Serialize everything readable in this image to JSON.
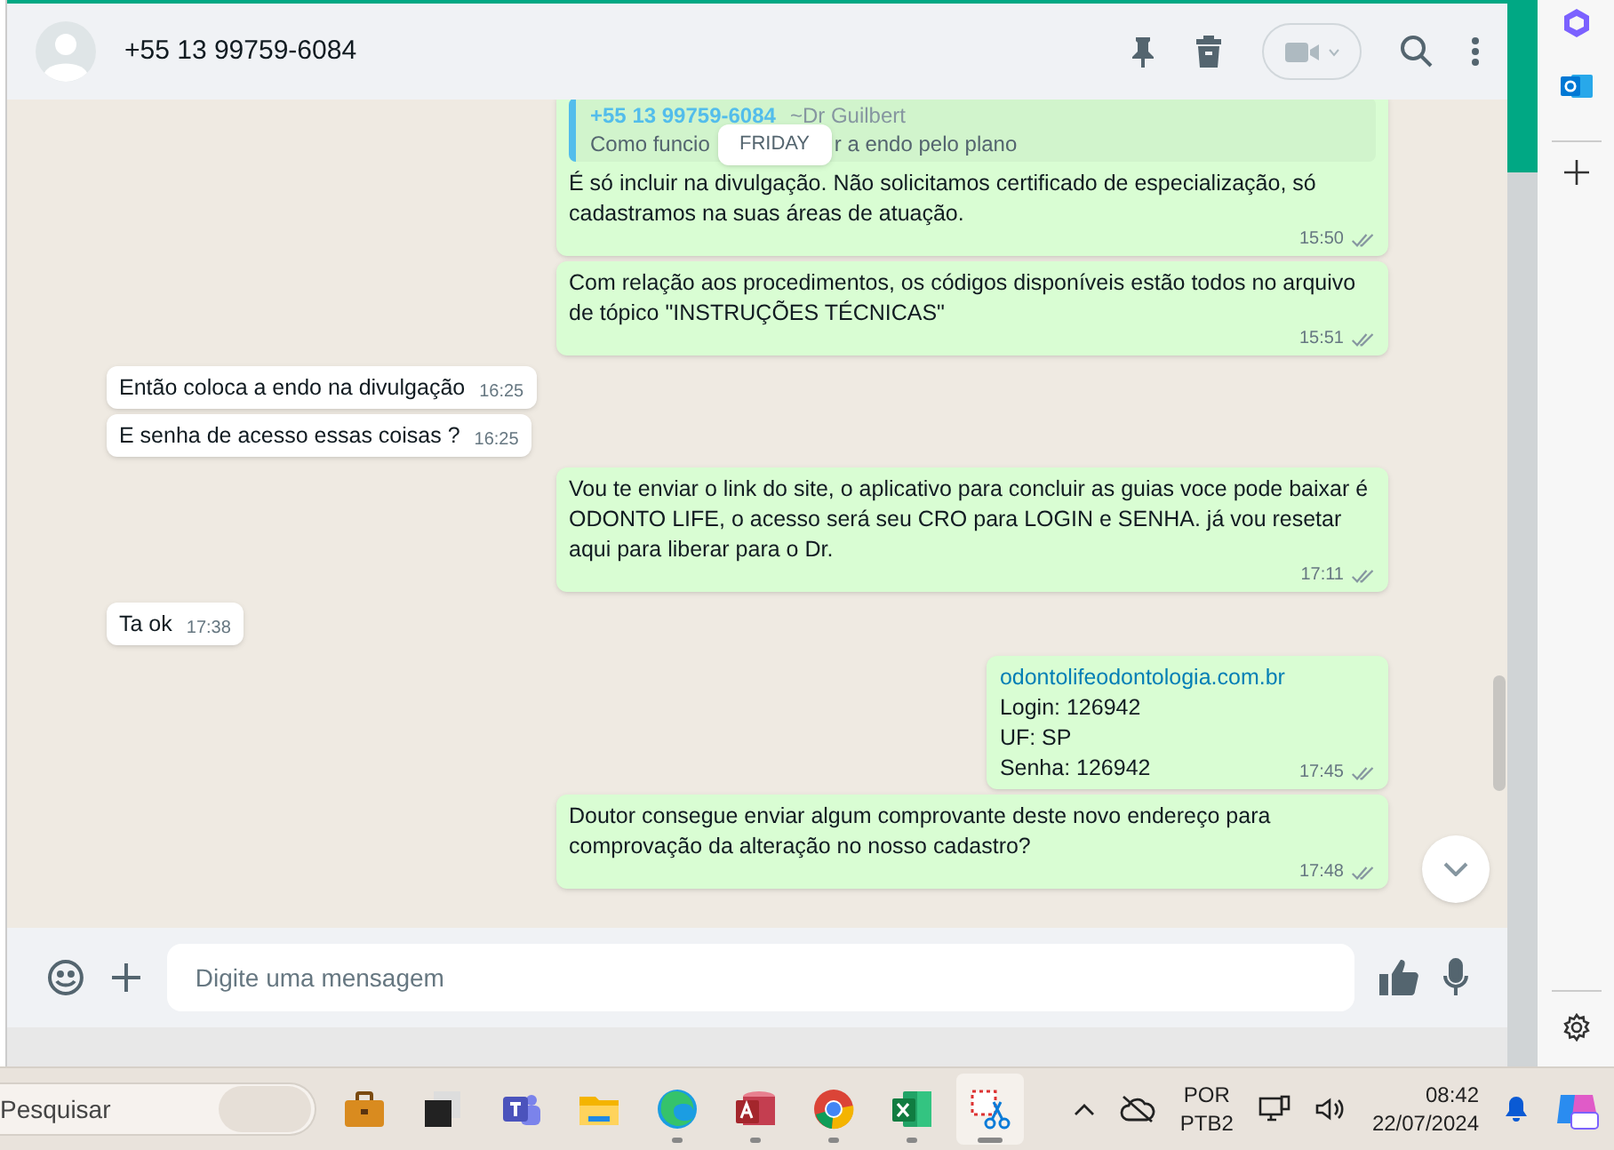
{
  "contact": {
    "name": "+55 13 99759-6084"
  },
  "date_badge": "FRIDAY",
  "messages": [
    {
      "outgoing": true,
      "quote": {
        "author": "+55 13 99759-6084",
        "author_note": "~Dr Guilbert",
        "text_parts": [
          "Como funcio",
          "r a endo pelo plano"
        ]
      },
      "lines": [
        {
          "kind": "text",
          "text": "É só incluir na divulgação. Não solicitamos certificado de especialização, só cadastramos na suas áreas de atuação."
        }
      ],
      "time": "15:50",
      "read": false
    },
    {
      "outgoing": true,
      "lines": [
        {
          "kind": "text",
          "text": "Com relação aos procedimentos, os códigos disponíveis estão todos no arquivo de tópico \"INSTRUÇÕES TÉCNICAS\""
        }
      ],
      "time": "15:51",
      "read": false
    },
    {
      "outgoing": false,
      "lines": [
        {
          "kind": "text",
          "text": "Então coloca a endo na divulgação"
        }
      ],
      "time": "16:25"
    },
    {
      "outgoing": false,
      "lines": [
        {
          "kind": "text",
          "text": "E senha de acesso essas coisas ?"
        }
      ],
      "time": "16:25"
    },
    {
      "outgoing": true,
      "lines": [
        {
          "kind": "text",
          "text": "Vou te enviar o link do site, o aplicativo para concluir as guias voce pode baixar é ODONTO LIFE, o acesso será seu CRO para LOGIN e SENHA. já vou resetar aqui para liberar para o Dr."
        }
      ],
      "time": "17:11",
      "read": false
    },
    {
      "outgoing": false,
      "lines": [
        {
          "kind": "text",
          "text": "Ta ok"
        }
      ],
      "time": "17:38"
    },
    {
      "outgoing": true,
      "lines": [
        {
          "kind": "link",
          "text": "odontolifeodontologia.com.br"
        },
        {
          "kind": "text",
          "text": "Login: 126942"
        },
        {
          "kind": "text",
          "text": "UF: SP"
        },
        {
          "kind": "text",
          "text": "Senha: 126942"
        }
      ],
      "time": "17:45",
      "read": false
    },
    {
      "outgoing": true,
      "lines": [
        {
          "kind": "text",
          "text": "Doutor consegue enviar algum comprovante deste novo endereço para comprovação da alteração no nosso cadastro?"
        }
      ],
      "time": "17:48",
      "read": false
    }
  ],
  "compose": {
    "placeholder": "Digite uma mensagem"
  },
  "taskbar": {
    "search_placeholder": "Pesquisar",
    "apps": [
      {
        "kind": "briefcase",
        "running": false,
        "selected": false
      },
      {
        "kind": "task-view",
        "running": false,
        "selected": false
      },
      {
        "kind": "teams",
        "running": false,
        "selected": false
      },
      {
        "kind": "folder",
        "running": false,
        "selected": false
      },
      {
        "kind": "edge",
        "running": true,
        "selected": false
      },
      {
        "kind": "access",
        "running": true,
        "selected": false
      },
      {
        "kind": "chrome",
        "running": true,
        "selected": false
      },
      {
        "kind": "excel",
        "running": true,
        "selected": false
      },
      {
        "kind": "snipping",
        "running": true,
        "selected": true
      }
    ],
    "input_language": "POR",
    "keyboard_layout": "PTB2",
    "time": "08:42",
    "date": "22/07/2024"
  }
}
